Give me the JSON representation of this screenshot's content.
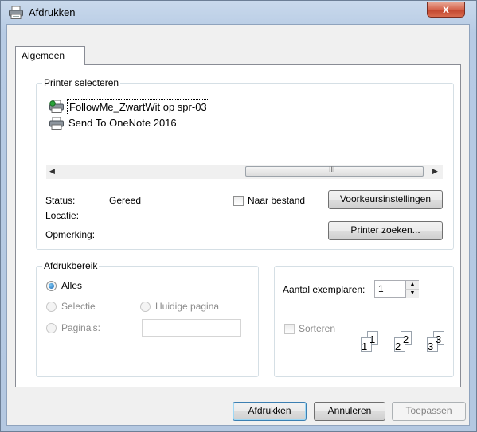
{
  "window": {
    "title": "Afdrukken",
    "close_glyph": "x"
  },
  "tabs": [
    {
      "label": "Algemeen"
    }
  ],
  "printer_select": {
    "legend": "Printer selecteren",
    "printers": [
      {
        "name": "FollowMe_ZwartWit op spr-03",
        "selected": true,
        "icon": "network-printer-icon"
      },
      {
        "name": "Send To OneNote 2016",
        "selected": false,
        "icon": "printer-icon"
      }
    ],
    "scroll_grip": "III",
    "status_label": "Status:",
    "status_value": "Gereed",
    "location_label": "Locatie:",
    "comment_label": "Opmerking:",
    "print_to_file_label": "Naar bestand",
    "print_to_file_checked": false,
    "preferences_button": "Voorkeursinstellingen",
    "find_printer_button": "Printer zoeken..."
  },
  "page_range": {
    "legend": "Afdrukbereik",
    "options": {
      "all": "Alles",
      "selection": "Selectie",
      "current_page": "Huidige pagina",
      "pages": "Pagina's:"
    },
    "selected": "all",
    "pages_value": ""
  },
  "copies": {
    "label": "Aantal exemplaren:",
    "value": "1",
    "collate_label": "Sorteren",
    "collate_checked": false,
    "collate_pages": [
      "1",
      "1",
      "2",
      "2",
      "3",
      "3"
    ]
  },
  "footer": {
    "print_button": "Afdrukken",
    "cancel_button": "Annuleren",
    "apply_button": "Toepassen"
  },
  "colors": {
    "title_bar": "#b9cde5",
    "close_button": "#c94a33",
    "dialog_bg": "#f0f0f0",
    "accent": "#3c7fb1"
  }
}
